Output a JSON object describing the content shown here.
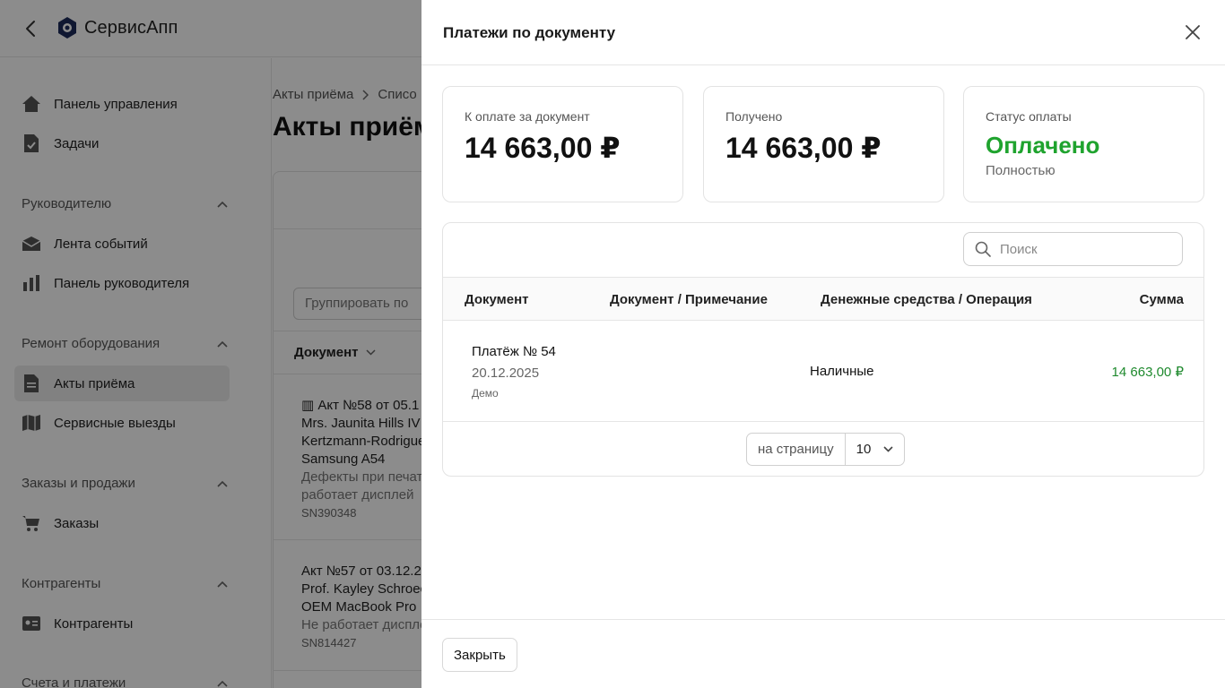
{
  "app": {
    "name": "СервисАпп",
    "sidebar": {
      "items": [
        {
          "label": "Панель управления",
          "icon": "home-icon"
        },
        {
          "label": "Задачи",
          "icon": "tasks-icon"
        }
      ],
      "groups": [
        {
          "title": "Руководителю",
          "items": [
            {
              "label": "Лента событий"
            },
            {
              "label": "Панель руководителя"
            }
          ]
        },
        {
          "title": "Ремонт оборудования",
          "items": [
            {
              "label": "Акты приёма",
              "active": true
            },
            {
              "label": "Сервисные выезды"
            }
          ]
        },
        {
          "title": "Заказы и продажи",
          "items": [
            {
              "label": "Заказы"
            }
          ]
        },
        {
          "title": "Контрагенты",
          "items": [
            {
              "label": "Контрагенты"
            }
          ]
        },
        {
          "title": "Счета и платежи"
        }
      ]
    },
    "main": {
      "breadcrumb": [
        "Акты приёма",
        "Списо"
      ],
      "title": "Акты приём",
      "group_placeholder": "Группировать по",
      "column_document": "Документ",
      "acts": [
        {
          "line1": "Акт №58 от 05.1",
          "line2": "Mrs. Jaunita Hills IV",
          "line3": "Kertzmann-Rodrigue",
          "line4": "Samsung A54",
          "line5": "Дефекты при печат",
          "line6": "работает дисплей",
          "sn": "SN390348"
        },
        {
          "line1": "Акт №57 от 03.12.20",
          "line2": "Prof. Kayley Schroec",
          "line3": "OEM MacBook Pro",
          "line5": "Не работает диспле",
          "sn": "SN814427"
        }
      ]
    }
  },
  "drawer": {
    "title": "Платежи по документу",
    "stats": {
      "due_label": "К оплате за документ",
      "due_value": "14 663,00 ₽",
      "received_label": "Получено",
      "received_value": "14 663,00 ₽",
      "status_label": "Статус оплаты",
      "status_value": "Оплачено",
      "status_sub": "Полностью"
    },
    "search_placeholder": "Поиск",
    "columns": {
      "document": "Документ",
      "note": "Документ / Примечание",
      "operation": "Денежные средства / Операция",
      "amount": "Сумма"
    },
    "rows": [
      {
        "title": "Платёж № 54",
        "date": "20.12.2025",
        "note": "Демо",
        "method": "Наличные",
        "amount": "14 663,00 ₽"
      }
    ],
    "pager": {
      "label": "на страницу",
      "value": "10"
    },
    "close_label": "Закрыть",
    "colors": {
      "status_green": "#1fa32e",
      "amount_green": "#1f8a2e"
    }
  }
}
